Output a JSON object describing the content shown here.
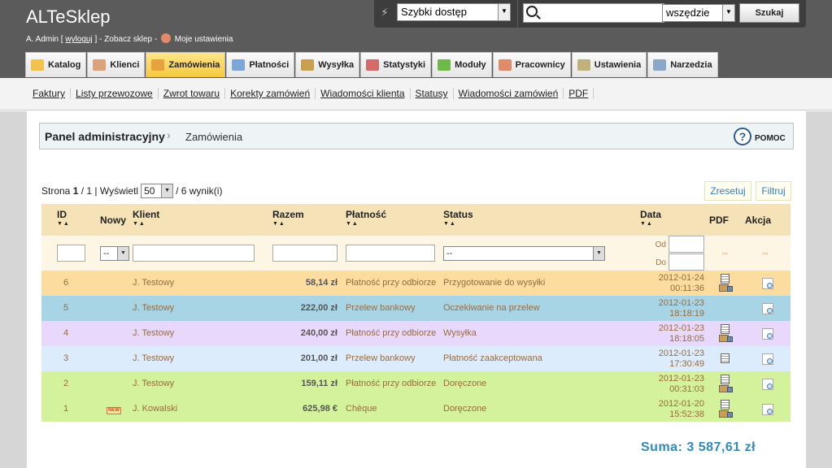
{
  "header": {
    "shop_name": "ALTeSklep",
    "admin_prefix": "A. Admin [",
    "logout": "wyloguj",
    "admin_mid": "] - Zobacz sklep -",
    "settings_link": "Moje ustawienia",
    "quick_access": "Szybki dostęp",
    "search_placeholder": "",
    "search_scope": "wszędzie",
    "search_button": "Szukaj"
  },
  "menu": [
    {
      "label": "Katalog",
      "icon": "folder-icon",
      "color": "#f2c14e",
      "active": false
    },
    {
      "label": "Klienci",
      "icon": "user-icon",
      "color": "#d9a27a",
      "active": false
    },
    {
      "label": "Zamówienia",
      "icon": "cart-icon",
      "color": "#e6a23c",
      "active": true
    },
    {
      "label": "Płatności",
      "icon": "payment-icon",
      "color": "#7aa7d8",
      "active": false
    },
    {
      "label": "Wysyłka",
      "icon": "truck-icon",
      "color": "#c8a050",
      "active": false
    },
    {
      "label": "Statystyki",
      "icon": "stats-icon",
      "color": "#d46b6b",
      "active": false
    },
    {
      "label": "Moduły",
      "icon": "puzzle-icon",
      "color": "#6fb84a",
      "active": false
    },
    {
      "label": "Pracownicy",
      "icon": "employee-icon",
      "color": "#e08a6a",
      "active": false
    },
    {
      "label": "Ustawienia",
      "icon": "settings-icon",
      "color": "#c0b07a",
      "active": false
    },
    {
      "label": "Narzedzia",
      "icon": "tools-icon",
      "color": "#8aa7c8",
      "active": false
    }
  ],
  "submenu": [
    "Faktury",
    "Listy przewozowe",
    "Zwrot towaru",
    "Korekty zamówień",
    "Wiadomości klienta",
    "Statusy",
    "Wiadomości zamówień",
    "PDF"
  ],
  "breadcrumb": {
    "panel": "Panel administracyjny",
    "separator": "›",
    "current": "Zamówienia",
    "help": "POMOC"
  },
  "pager": {
    "prefix": "Strona",
    "page": "1",
    "of": "/ 1 | Wyświetl",
    "per_page": "50",
    "results": "/ 6 wynik(i)"
  },
  "buttons": {
    "reset": "Zresetuj",
    "filter": "Filtruj"
  },
  "columns": {
    "id": "ID",
    "new": "Nowy",
    "client": "Klient",
    "total": "Razem",
    "payment": "Płatność",
    "status": "Status",
    "date": "Data",
    "pdf": "PDF",
    "action": "Akcja",
    "sort_arrows": "▼▲"
  },
  "filters": {
    "new_value": "--",
    "status_value": "--",
    "date_from": "Od",
    "date_to": "Do",
    "pdf_dash": "--",
    "action_dash": "--"
  },
  "orders": [
    {
      "id": "6",
      "new": "",
      "client": "J. Testowy",
      "total": "58,14 zł",
      "payment": "Płatność przy odbiorze",
      "status": "Przygotowanie do wysyłki",
      "date": "2012-01-24",
      "time": "00:11:36",
      "row_color": "#fddca0",
      "pdf": [
        "invoice-icon",
        "delivery-slip-icon"
      ]
    },
    {
      "id": "5",
      "new": "",
      "client": "J. Testowy",
      "total": "222,00 zł",
      "payment": "Przelew bankowy",
      "status": "Oczekiwanie na przelew",
      "date": "2012-01-23",
      "time": "18:18:19",
      "row_color": "#a8d5e5",
      "pdf": []
    },
    {
      "id": "4",
      "new": "",
      "client": "J. Testowy",
      "total": "240,00 zł",
      "payment": "Płatność przy odbiorze",
      "status": "Wysyłka",
      "date": "2012-01-23",
      "time": "18:18:05",
      "row_color": "#e8d8fb",
      "pdf": [
        "invoice-icon",
        "delivery-slip-icon"
      ]
    },
    {
      "id": "3",
      "new": "",
      "client": "J. Testowy",
      "total": "201,00 zł",
      "payment": "Przelew bankowy",
      "status": "Płatność zaakceptowana",
      "date": "2012-01-23",
      "time": "17:30:49",
      "row_color": "#dcecfc",
      "pdf": [
        "invoice-icon"
      ]
    },
    {
      "id": "2",
      "new": "",
      "client": "J. Testowy",
      "total": "159,11 zł",
      "payment": "Płatność przy odbiorze",
      "status": "Doręczone",
      "date": "2012-01-23",
      "time": "00:31:03",
      "row_color": "#d3f29b",
      "pdf": [
        "invoice-icon",
        "delivery-slip-icon"
      ]
    },
    {
      "id": "1",
      "new": "NEW",
      "client": "J. Kowalski",
      "total": "625,98 €",
      "payment": "Chèque",
      "status": "Doręczone",
      "date": "2012-01-20",
      "time": "15:52:38",
      "row_color": "#d3f29b",
      "pdf": [
        "invoice-icon",
        "delivery-slip-icon"
      ]
    }
  ],
  "sum_label": "Suma: 3 587,61 zł"
}
